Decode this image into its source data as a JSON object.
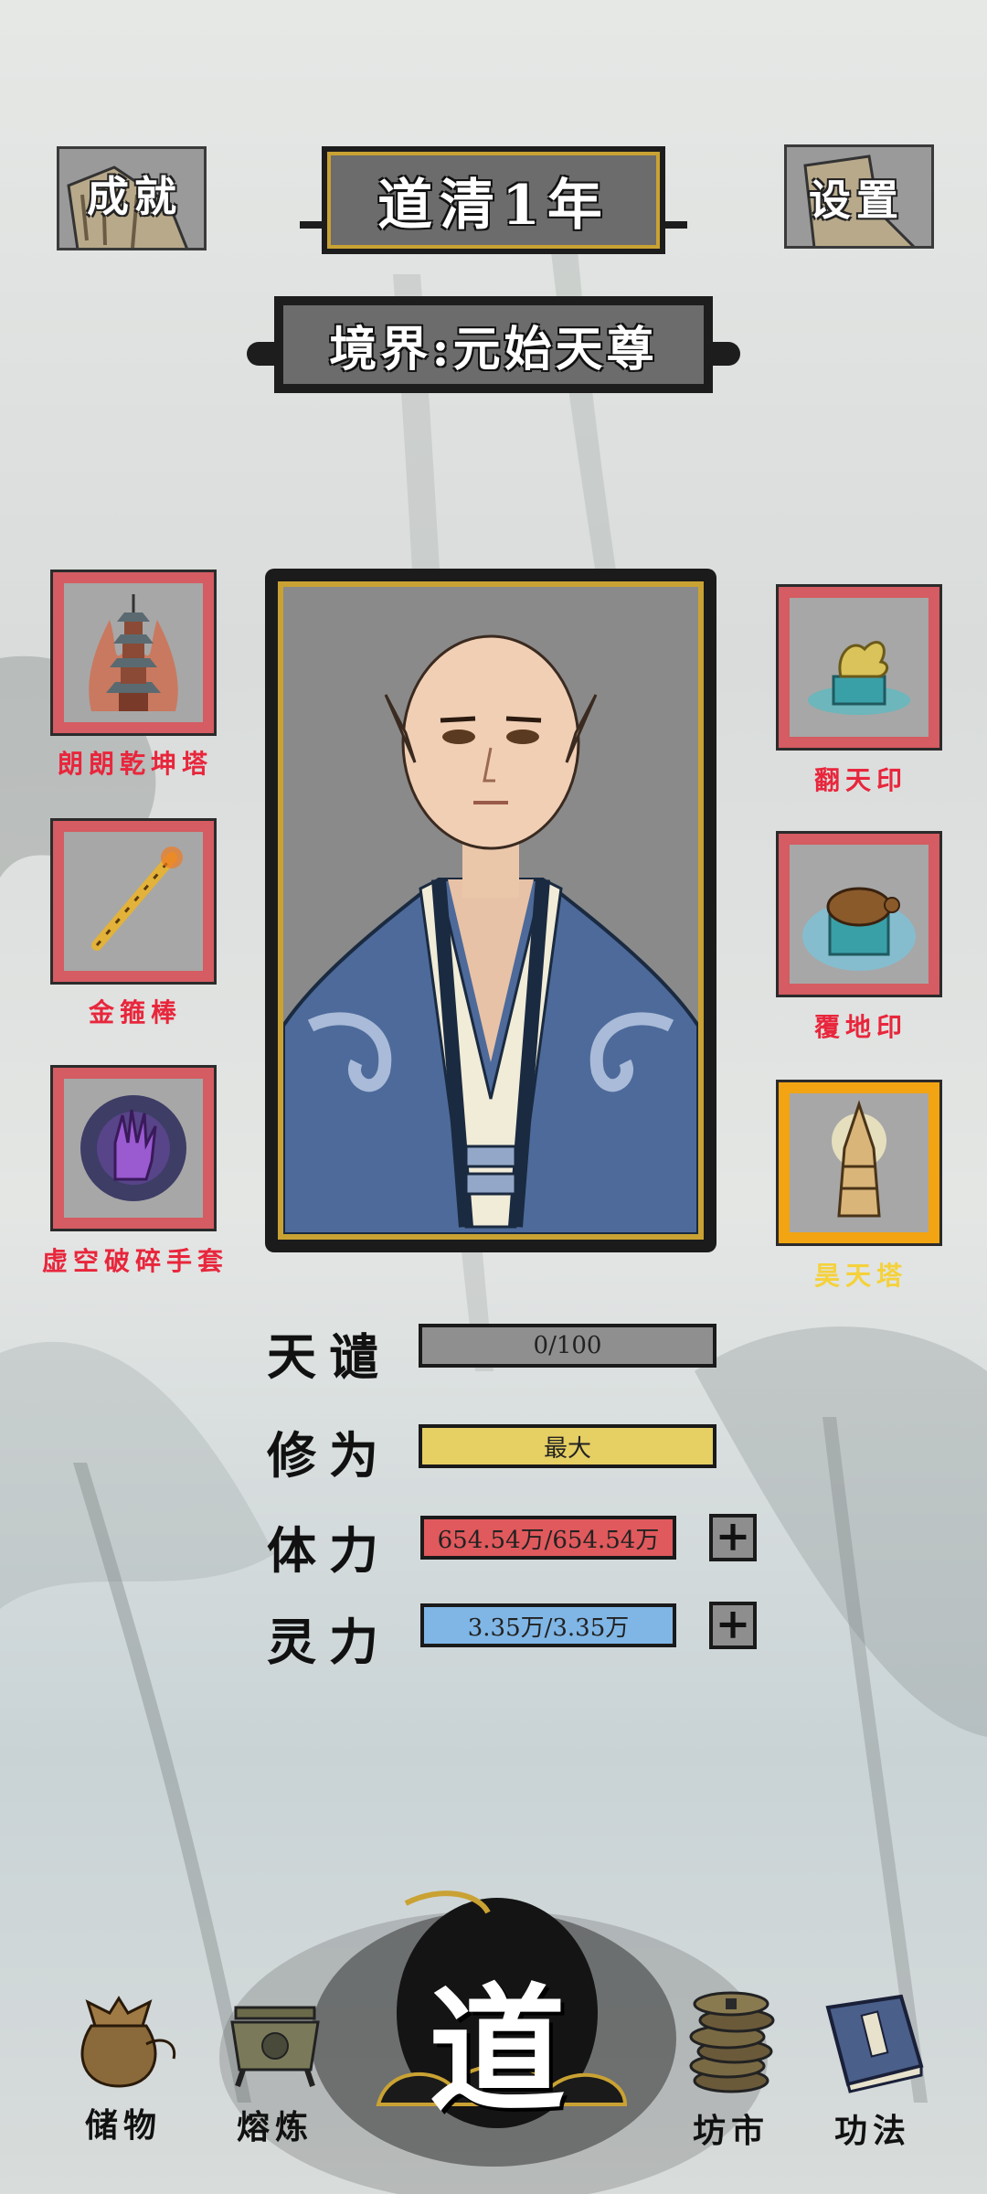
{
  "header": {
    "achievements_label": "成就",
    "era_title": "道清1年",
    "settings_label": "设置",
    "realm_title": "境界:元始天尊"
  },
  "left_items": [
    {
      "name": "朗朗乾坤塔",
      "icon": "pagoda-icon"
    },
    {
      "name": "金箍棒",
      "icon": "golden-staff-icon"
    },
    {
      "name": "虚空破碎手套",
      "icon": "void-glove-icon"
    }
  ],
  "right_items": [
    {
      "name": "翻天印",
      "icon": "dragon-seal-icon"
    },
    {
      "name": "覆地印",
      "icon": "turtle-seal-icon"
    },
    {
      "name": "昊天塔",
      "icon": "tower-icon",
      "highlight": true
    }
  ],
  "stats": {
    "tribulation": {
      "label": "天谴",
      "value": "0/100",
      "color": "#8f8f8f"
    },
    "cultivation": {
      "label": "修为",
      "value": "最大",
      "color": "#e6cf63"
    },
    "stamina": {
      "label": "体力",
      "value": "654.54万/654.54万",
      "color": "#e0595c"
    },
    "spirit": {
      "label": "灵力",
      "value": "3.35万/3.35万",
      "color": "#7fb6e6"
    }
  },
  "nav": {
    "storage": "储物",
    "smelting": "熔炼",
    "dao": "道",
    "market": "坊市",
    "techniques": "功法"
  },
  "colors": {
    "item_border": "#d45c62",
    "item_border_highlight": "#f2a412",
    "frame_gold": "#c9a233"
  }
}
